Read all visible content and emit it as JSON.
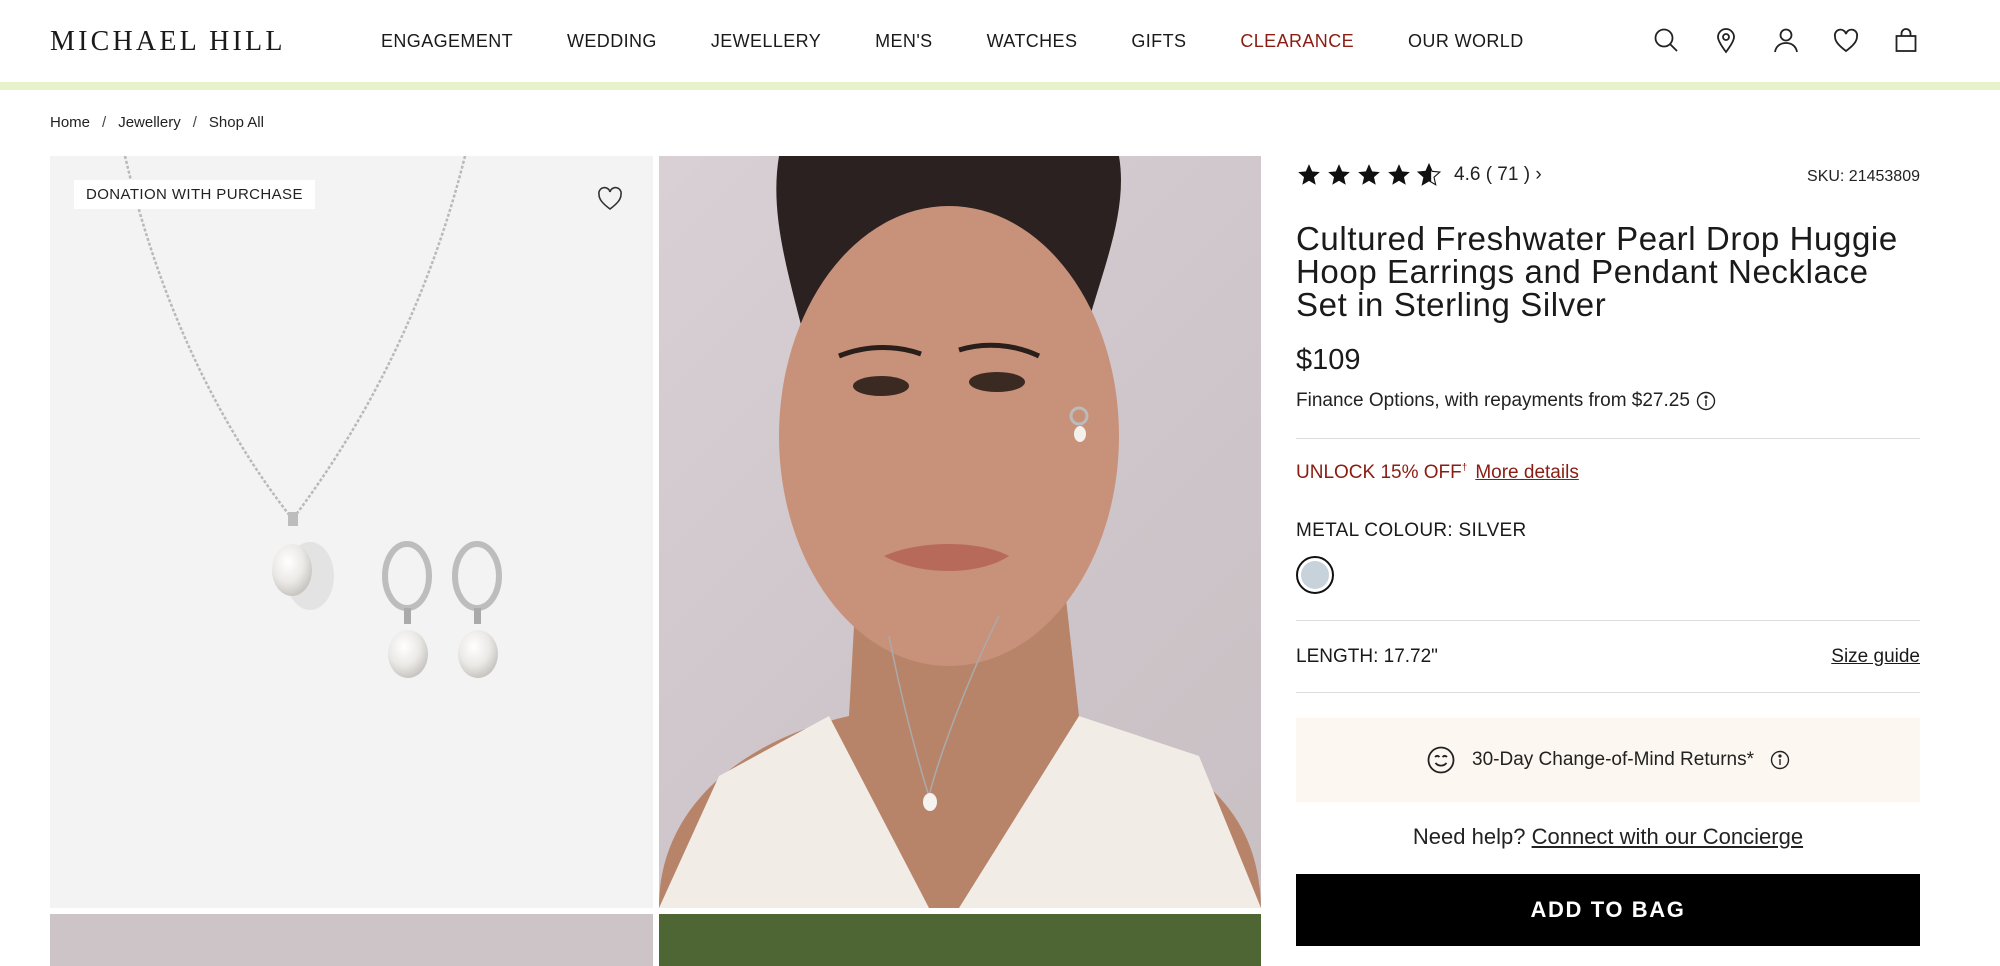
{
  "header": {
    "logo": "MICHAEL HILL",
    "nav": [
      "ENGAGEMENT",
      "WEDDING",
      "JEWELLERY",
      "MEN'S",
      "WATCHES",
      "GIFTS",
      "CLEARANCE",
      "OUR WORLD"
    ],
    "icons": [
      "search-icon",
      "store-locator-icon",
      "account-icon",
      "wishlist-icon",
      "bag-icon"
    ],
    "accent_color": "#e6f2c9",
    "clearance_color": "#8a1c12"
  },
  "breadcrumb": [
    "Home",
    "Jewellery",
    "Shop All"
  ],
  "gallery": {
    "badge": "DONATION WITH PURCHASE"
  },
  "product": {
    "rating": 4.6,
    "rating_text": "4.6 ( 71 ) ›",
    "sku": "SKU: 21453809",
    "title": "Cultured Freshwater Pearl Drop Huggie Hoop Earrings and Pendant Necklace Set in Sterling Silver",
    "price": "$109",
    "finance": "Finance Options, with repayments from $27.25",
    "unlock": "UNLOCK 15% OFF",
    "unlock_sup": "†",
    "more_details": "More details",
    "metal_label": "METAL COLOUR: SILVER",
    "swatch_color": "#c8d2da",
    "length": "LENGTH: 17.72\"",
    "size_guide": "Size guide",
    "returns": "30-Day Change-of-Mind Returns*",
    "help_prefix": "Need help?",
    "help_link": "Connect with our Concierge",
    "add_to_bag": "ADD TO BAG"
  }
}
